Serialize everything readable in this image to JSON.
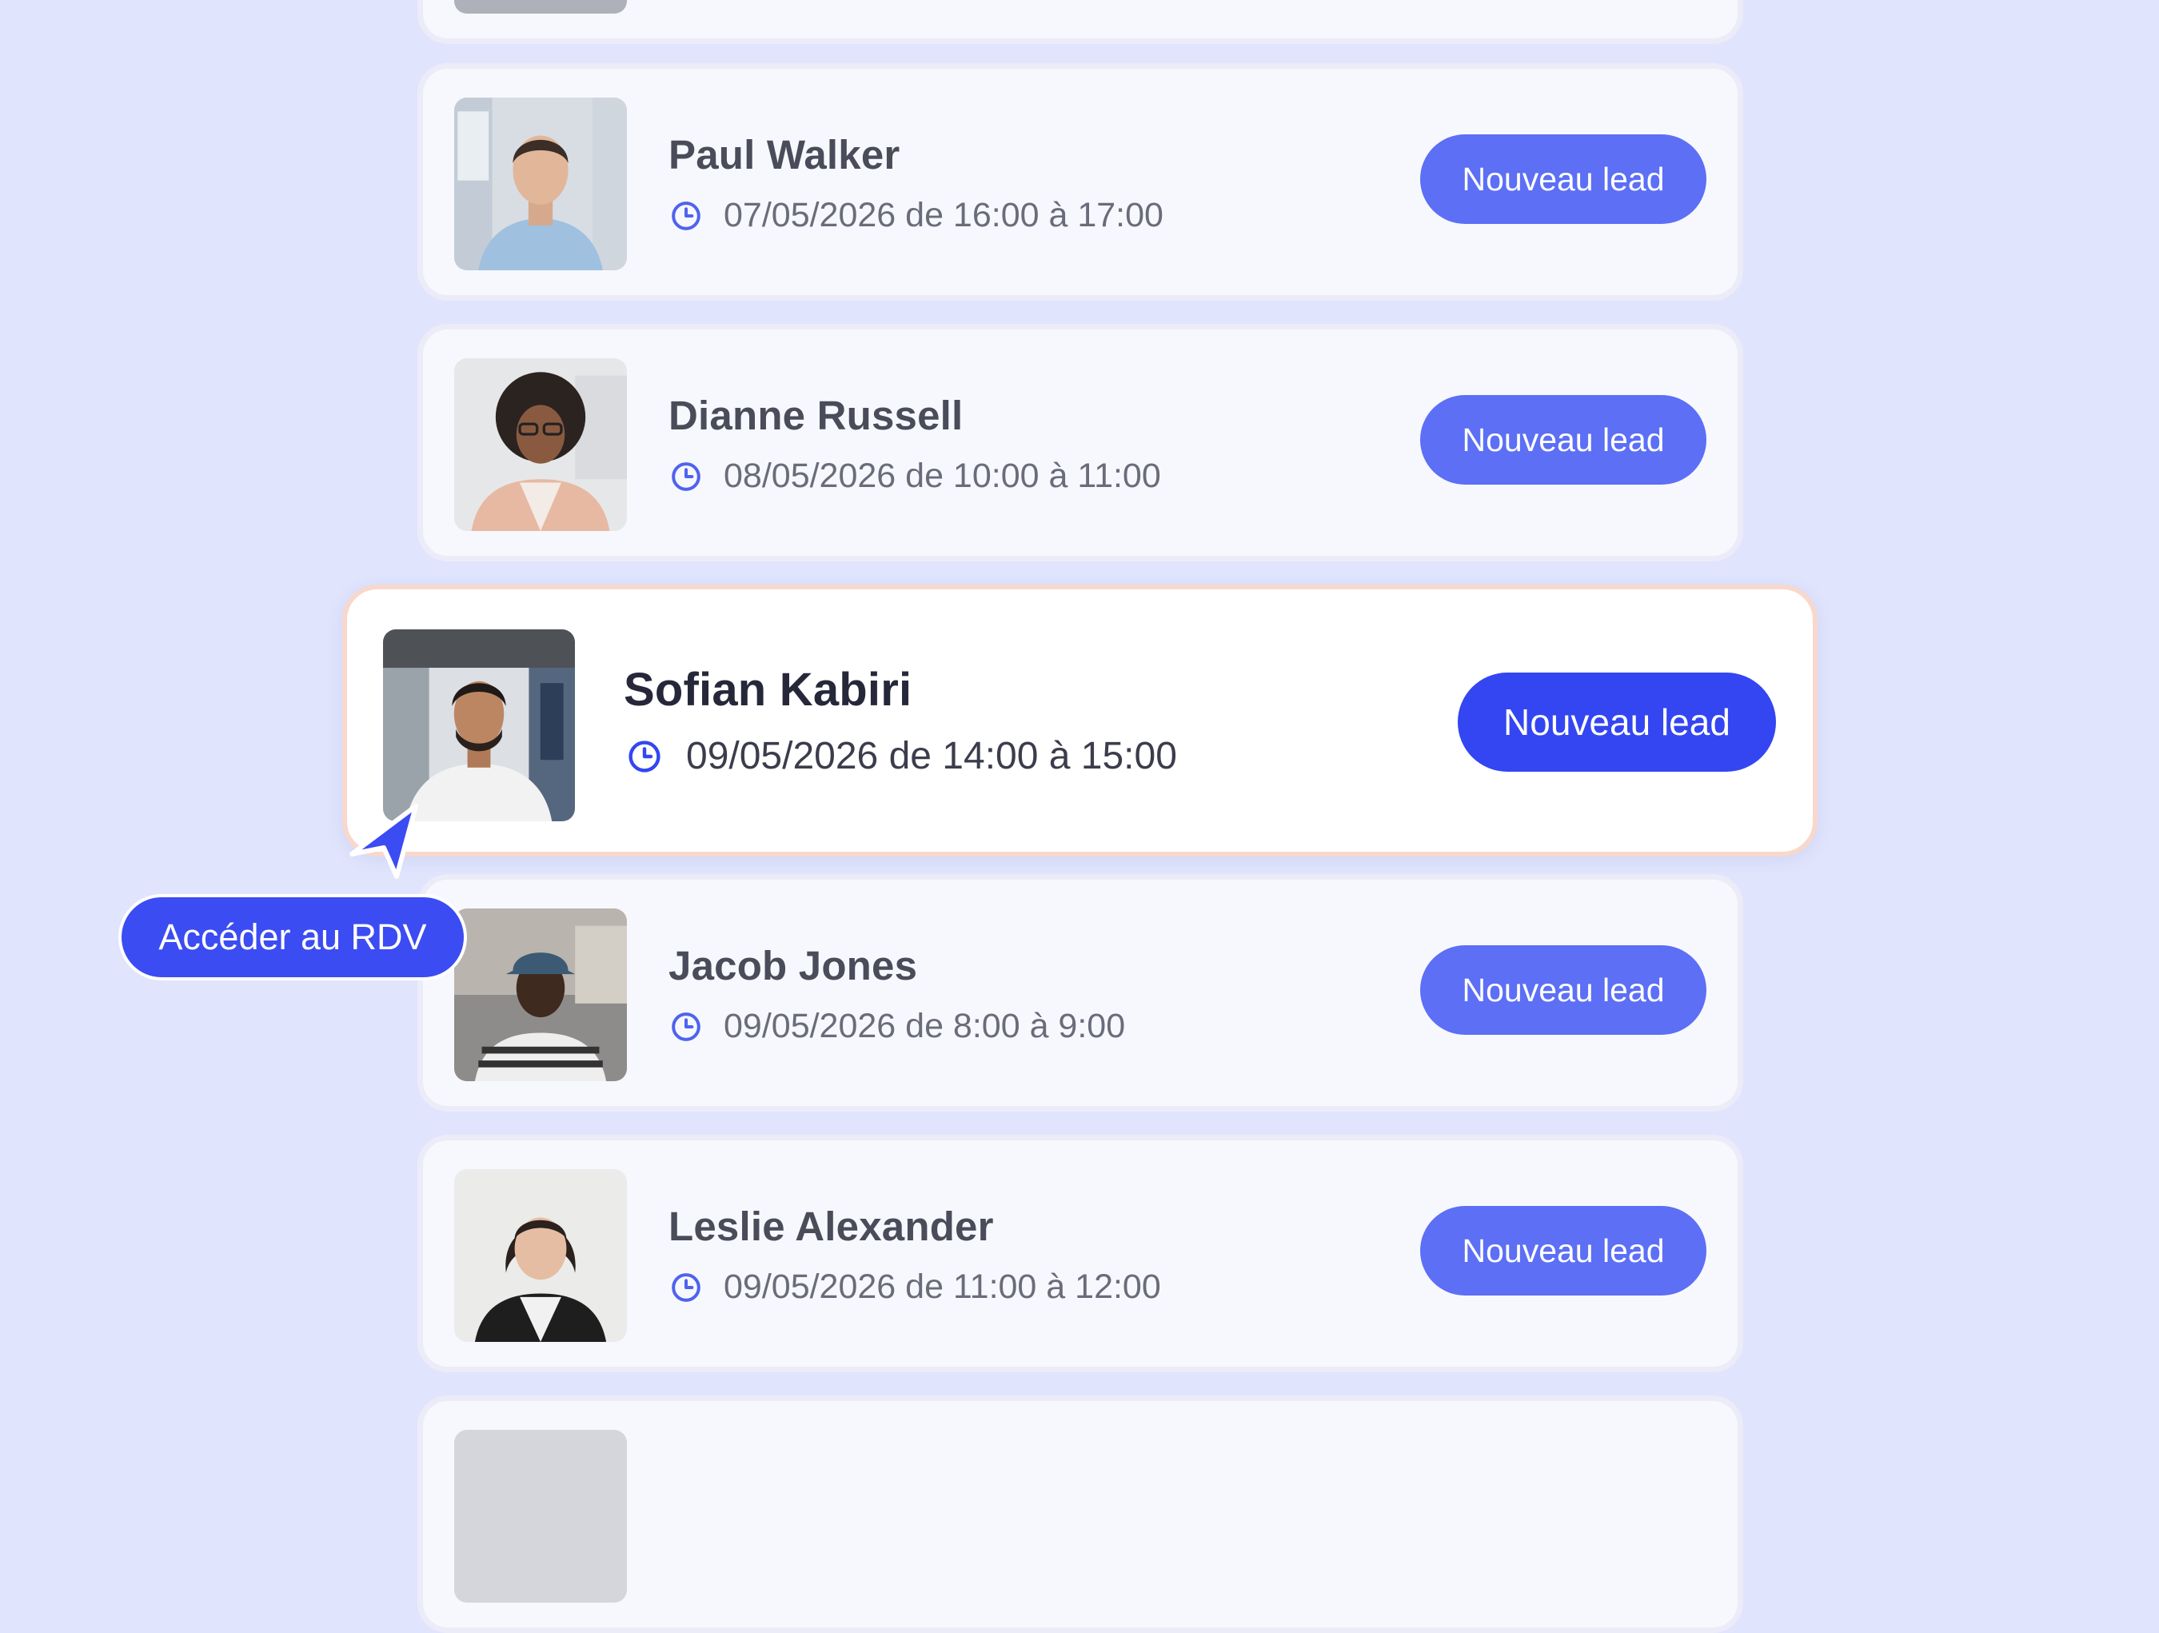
{
  "items": [
    {
      "name": "Paul Walker",
      "datetime": "07/05/2026 de 16:00 à 17:00",
      "button_label": "Nouveau lead"
    },
    {
      "name": "Dianne Russell",
      "datetime": "08/05/2026 de 10:00 à 11:00",
      "button_label": "Nouveau lead"
    },
    {
      "name": "Sofian Kabiri",
      "datetime": "09/05/2026 de 14:00 à 15:00",
      "button_label": "Nouveau lead"
    },
    {
      "name": "Jacob Jones",
      "datetime": "09/05/2026 de 8:00 à 9:00",
      "button_label": "Nouveau lead"
    },
    {
      "name": "Leslie Alexander",
      "datetime": "09/05/2026 de 11:00 à 12:00",
      "button_label": "Nouveau lead"
    }
  ],
  "tooltip": {
    "label": "Accéder au RDV"
  },
  "icons": {
    "time": "clock-icon",
    "pointer": "cursor-arrow-icon"
  },
  "colors": {
    "background": "#e0e4fc",
    "button": "#5c6ff5",
    "button_active": "#3346f2",
    "highlight_border": "#f8d8cc"
  }
}
